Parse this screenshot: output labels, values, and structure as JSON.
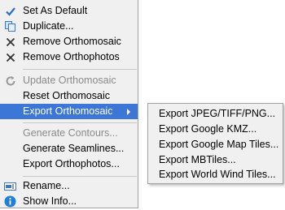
{
  "menu": {
    "items": [
      {
        "label": "Set As Default",
        "icon": "check-icon",
        "disabled": false
      },
      {
        "label": "Duplicate...",
        "icon": "duplicate-icon",
        "disabled": false
      },
      {
        "label": "Remove Orthomosaic",
        "icon": "remove-icon",
        "disabled": false
      },
      {
        "label": "Remove Orthophotos",
        "icon": "remove-icon",
        "disabled": false
      },
      {
        "label": "Update Orthomosaic",
        "icon": "refresh-icon",
        "disabled": true
      },
      {
        "label": "Reset Orthomosaic",
        "icon": null,
        "disabled": false
      },
      {
        "label": "Export Orthomosaic",
        "icon": null,
        "disabled": false,
        "has_submenu": true,
        "highlighted": true
      },
      {
        "label": "Generate Contours...",
        "icon": null,
        "disabled": true
      },
      {
        "label": "Generate Seamlines...",
        "icon": null,
        "disabled": false
      },
      {
        "label": "Export Orthophotos...",
        "icon": null,
        "disabled": false
      },
      {
        "label": "Rename...",
        "icon": "rename-icon",
        "disabled": false
      },
      {
        "label": "Show Info...",
        "icon": "info-icon",
        "disabled": false
      }
    ]
  },
  "submenu": {
    "items": [
      {
        "label": "Export JPEG/TIFF/PNG..."
      },
      {
        "label": "Export Google KMZ..."
      },
      {
        "label": "Export Google Map Tiles..."
      },
      {
        "label": "Export MBTiles..."
      },
      {
        "label": "Export World Wind Tiles..."
      }
    ]
  },
  "colors": {
    "highlight": "#3c76d6",
    "check": "#2a6bd1",
    "info": "#1e7fd8",
    "disabled_text": "#8a8a8a"
  }
}
